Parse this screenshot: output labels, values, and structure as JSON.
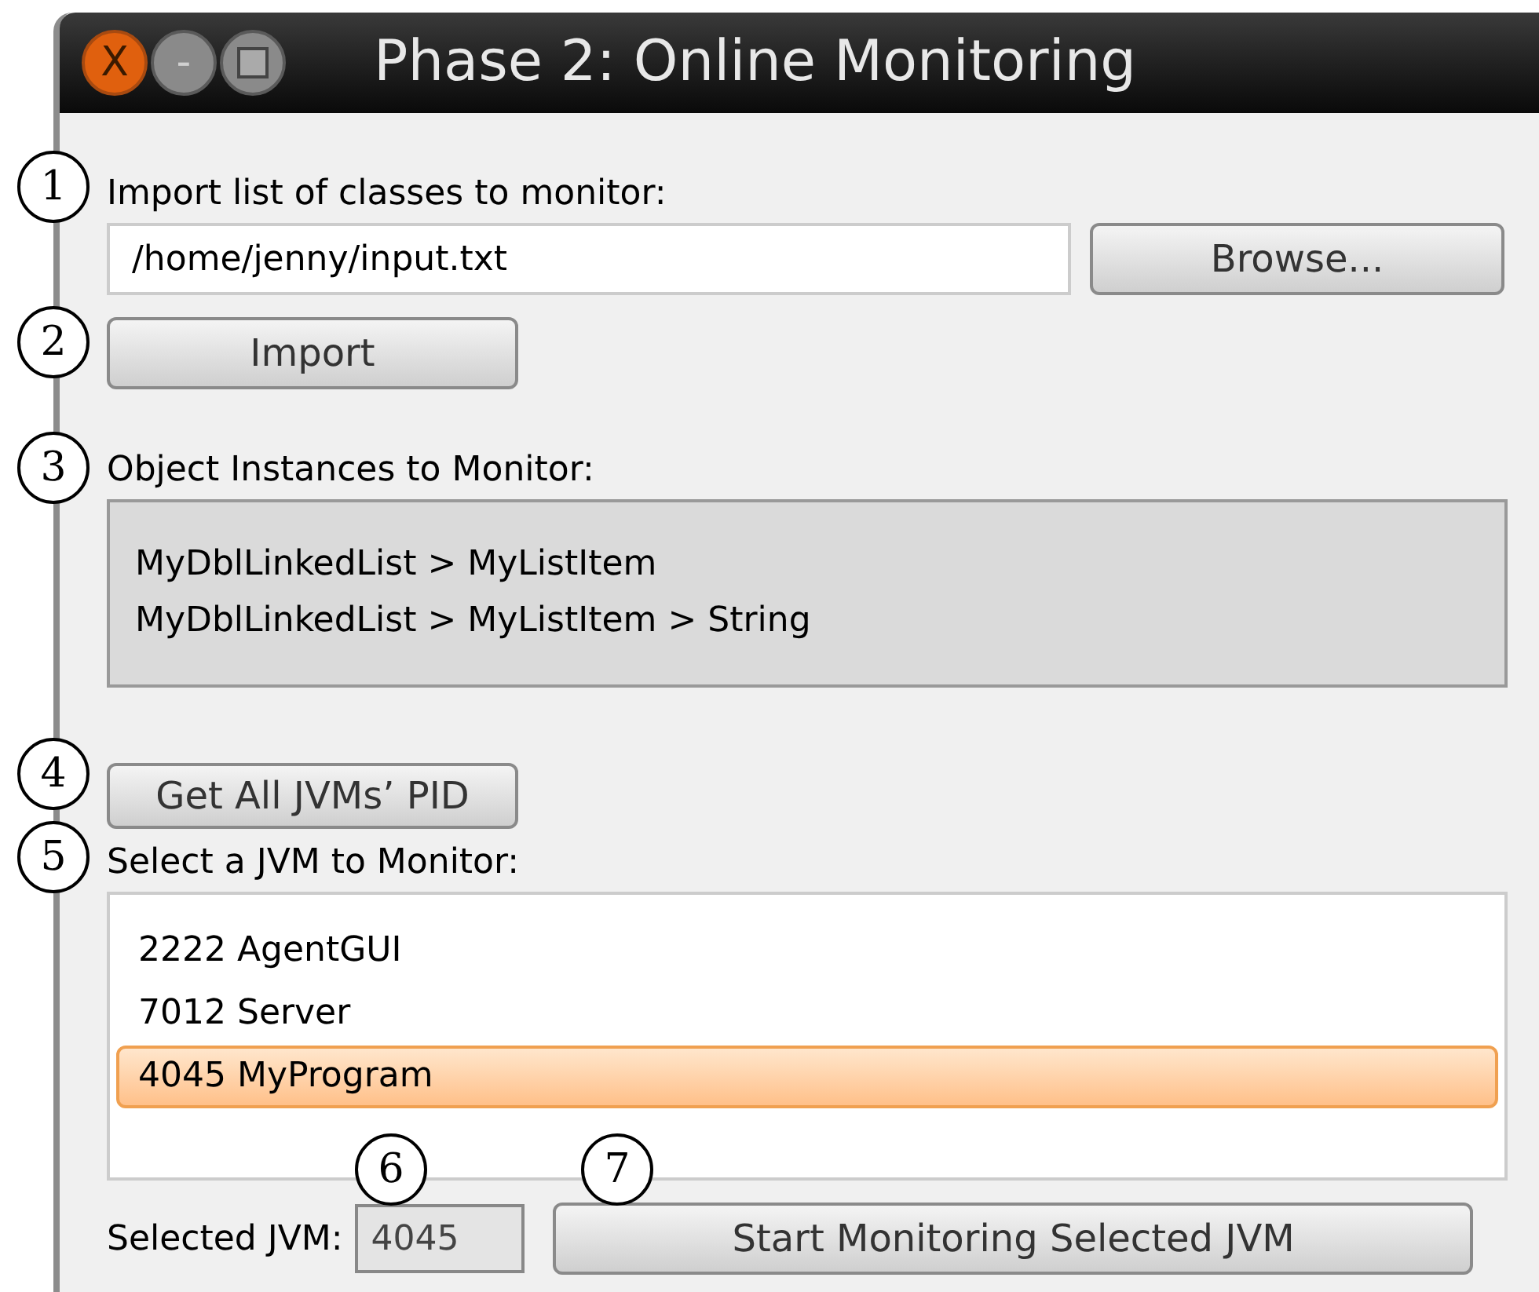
{
  "window": {
    "title": "Phase 2: Online Monitoring",
    "controls": [
      {
        "kind": "close",
        "label": "X"
      },
      {
        "kind": "minimize",
        "label": "-"
      },
      {
        "kind": "maximize"
      }
    ]
  },
  "import_section": {
    "label": "Import list of classes to monitor:",
    "path_field": {
      "value": "/home/jenny/input.txt"
    },
    "browse_button": "Browse...",
    "import_button": "Import"
  },
  "instances_section": {
    "label": "Object Instances to Monitor:",
    "items": [
      "MyDblLinkedList > MyListItem",
      "MyDblLinkedList > MyListItem > String"
    ]
  },
  "get_pids_button": "Get All JVMs’ PID",
  "jvm_section": {
    "label": "Select a JVM to Monitor:",
    "items": [
      {
        "text": "2222 AgentGUI",
        "selected": false
      },
      {
        "text": "7012 Server",
        "selected": false
      },
      {
        "text": "4045 MyProgram",
        "selected": true
      }
    ]
  },
  "selected_jvm": {
    "label": "Selected JVM:",
    "value": "4045"
  },
  "start_button": "Start Monitoring Selected JVM",
  "annotations": [
    "1",
    "2",
    "3",
    "4",
    "5",
    "6",
    "7"
  ]
}
